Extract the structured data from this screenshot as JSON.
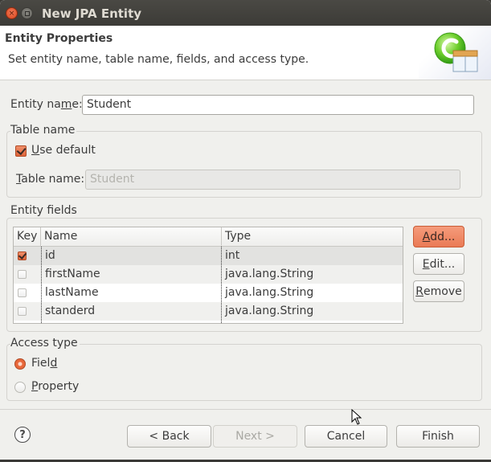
{
  "window": {
    "title": "New JPA Entity"
  },
  "banner": {
    "title": "Entity Properties",
    "description": "Set entity name, table name, fields, and access type.",
    "icon": "jpa-entity-wizard-icon"
  },
  "entity_name": {
    "label_pre": "Entity na",
    "label_mnemonic": "m",
    "label_post": "e:",
    "value": "Student"
  },
  "table_name_group": {
    "legend": "Table name",
    "use_default": {
      "label_mnemonic": "U",
      "label_rest": "se default",
      "checked": true
    },
    "table_name": {
      "label_mnemonic": "T",
      "label_rest": "able name:",
      "value": "Student",
      "enabled": false
    }
  },
  "entity_fields_group": {
    "legend": "Entity fields",
    "columns": [
      "Key",
      "Name",
      "Type"
    ],
    "rows": [
      {
        "key": true,
        "name": "id",
        "type": "int"
      },
      {
        "key": false,
        "name": "firstName",
        "type": "java.lang.String"
      },
      {
        "key": false,
        "name": "lastName",
        "type": "java.lang.String"
      },
      {
        "key": false,
        "name": "standerd",
        "type": "java.lang.String"
      }
    ],
    "buttons": {
      "add": {
        "mnemonic": "A",
        "rest": "dd..."
      },
      "edit": {
        "mnemonic": "E",
        "rest": "dit..."
      },
      "remove": {
        "mnemonic": "R",
        "rest": "emove"
      }
    }
  },
  "access_type_group": {
    "legend": "Access type",
    "options": [
      {
        "pre": "Fiel",
        "mnemonic": "d",
        "post": "",
        "selected": true
      },
      {
        "pre": "",
        "mnemonic": "P",
        "post": "roperty",
        "selected": false
      }
    ]
  },
  "footer": {
    "help_glyph": "?",
    "back": "< Back",
    "next": "Next >",
    "cancel": "Cancel",
    "finish": "Finish"
  },
  "colors": {
    "accent": "#ea7a55",
    "titlebar": "#3c3b37",
    "dialog_bg": "#f0f0ed"
  }
}
